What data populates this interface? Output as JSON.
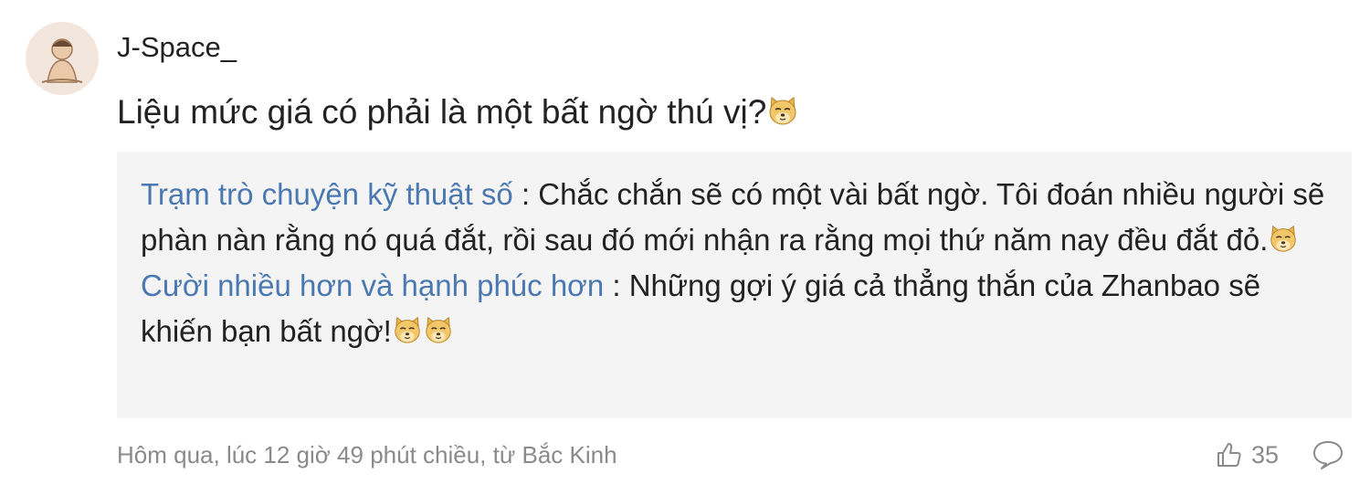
{
  "comment": {
    "username": "J-Space_",
    "text": "Liệu mức giá có phải là một bất ngờ thú vị?",
    "emoji_icon": "doge-emoji-icon",
    "meta": "Hôm qua, lúc 12 giờ 49 phút chiều, từ Bắc Kinh",
    "like_count": "35"
  },
  "replies": [
    {
      "user": "Trạm trò chuyện kỹ thuật số",
      "separator": " : ",
      "text": "Chắc chắn sẽ có một vài bất ngờ. Tôi đoán nhiều người sẽ phàn nàn rằng nó quá đắt, rồi sau đó mới nhận ra rằng mọi thứ năm nay đều đắt đỏ."
    },
    {
      "user": "Cười nhiều hơn và hạnh phúc hơn",
      "separator": " : ",
      "text": "Những gợi ý giá cả thẳng thắn của Zhanbao sẽ khiến bạn bất ngờ!"
    }
  ],
  "colors": {
    "reply_user": "#4a78b0",
    "reply_bg": "#f4f4f4",
    "meta_text": "#8a8a8a"
  }
}
